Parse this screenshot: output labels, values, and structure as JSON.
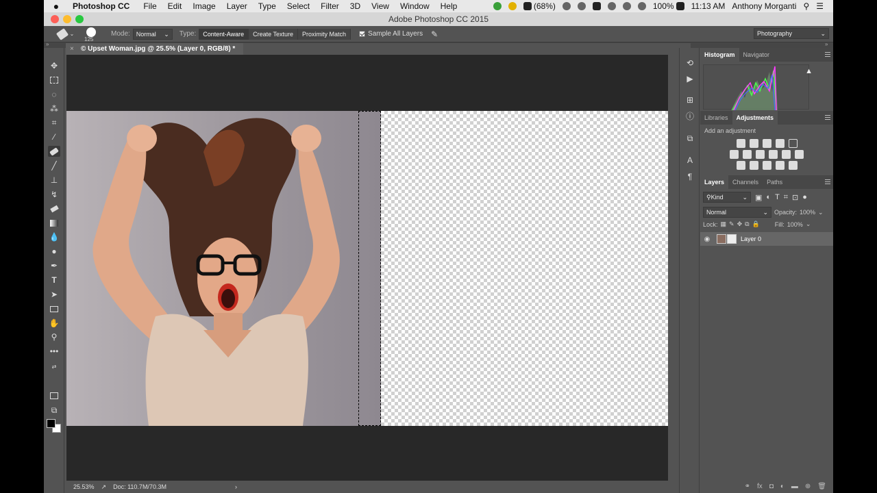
{
  "menubar": {
    "apple": "",
    "app": "Photoshop CC",
    "items": [
      "File",
      "Edit",
      "Image",
      "Layer",
      "Type",
      "Select",
      "Filter",
      "3D",
      "View",
      "Window",
      "Help"
    ],
    "battery_small": "(68%)",
    "battery": "100%",
    "time": "11:13 AM",
    "user": "Anthony Morganti"
  },
  "titlebar": {
    "title": "Adobe Photoshop CC 2015"
  },
  "options": {
    "brush_size": "125",
    "mode_label": "Mode:",
    "mode_value": "Normal",
    "type_label": "Type:",
    "type_options": [
      "Content-Aware",
      "Create Texture",
      "Proximity Match"
    ],
    "type_selected": "Content-Aware",
    "sample_all_layers": "Sample All Layers",
    "workspace": "Photography"
  },
  "document": {
    "tab_title": "© Upset Woman.jpg @ 25.5% (Layer 0, RGB/8) *",
    "zoom": "25.53%",
    "doc_size": "Doc: 110.7M/70.3M"
  },
  "tools": [
    "move",
    "marquee",
    "lasso",
    "quick-selection",
    "crop",
    "eyedropper",
    "spot-healing",
    "brush",
    "clone-stamp",
    "history-brush",
    "eraser",
    "gradient",
    "blur",
    "dodge",
    "pen",
    "type",
    "path-selection",
    "rectangle",
    "hand",
    "zoom",
    "more"
  ],
  "panels": {
    "histogram_tabs": [
      "Histogram",
      "Navigator"
    ],
    "adjust_tabs": [
      "Libraries",
      "Adjustments"
    ],
    "add_adjustment": "Add an adjustment",
    "layers_tabs": [
      "Layers",
      "Channels",
      "Paths"
    ],
    "filter_kind": "Kind",
    "blend_mode": "Normal",
    "opacity_label": "Opacity:",
    "opacity_value": "100%",
    "lock_label": "Lock:",
    "fill_label": "Fill:",
    "fill_value": "100%",
    "layers": [
      {
        "name": "Layer 0"
      }
    ]
  },
  "colors": {
    "panel_bg": "#535353",
    "canvas_bg": "#282828",
    "foreground": "#000000",
    "background": "#ffffff"
  }
}
